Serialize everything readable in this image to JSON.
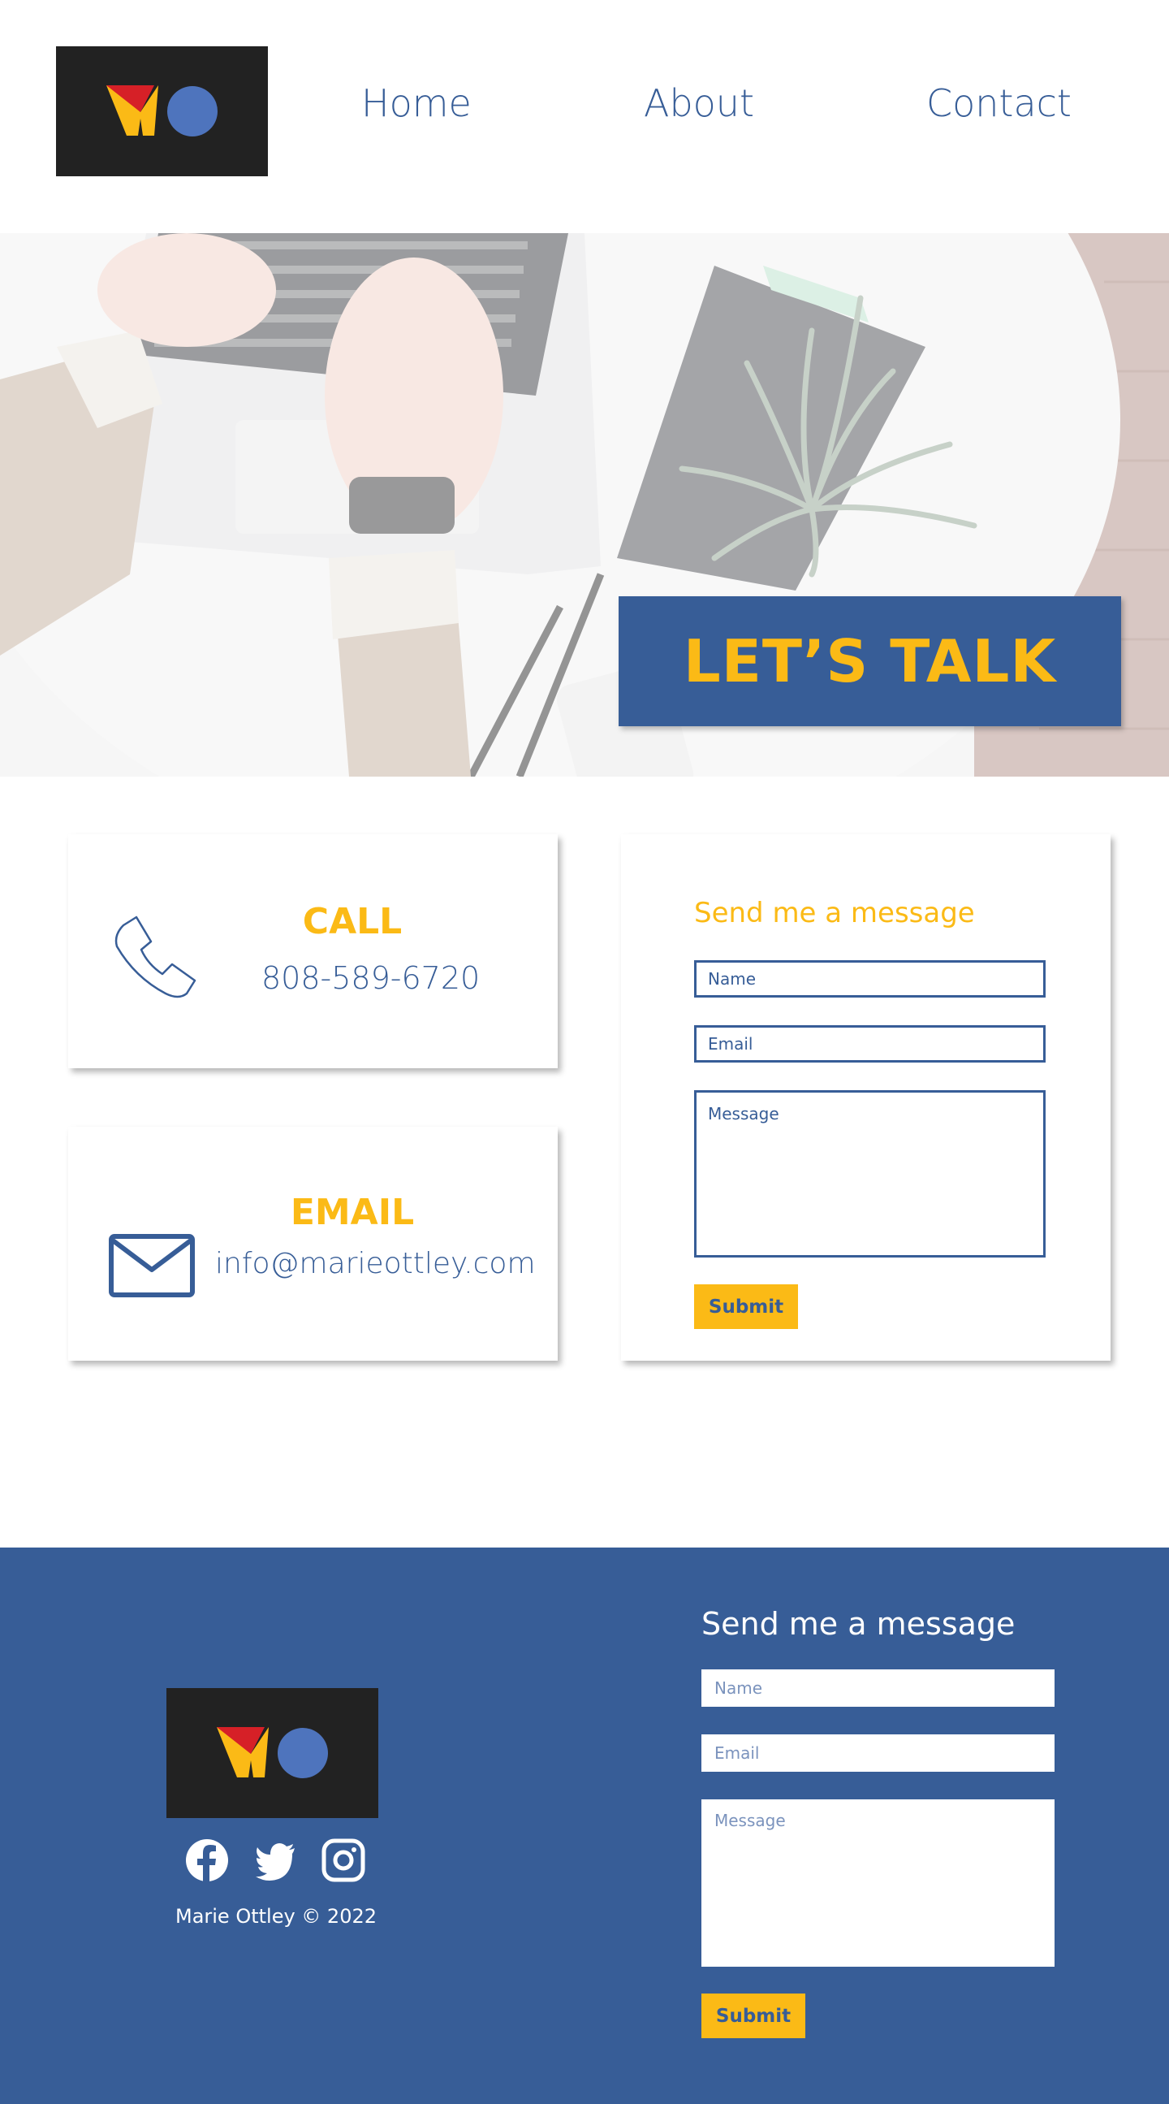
{
  "header": {
    "logo_icon": "mo-logo-icon",
    "nav": [
      {
        "label": "Home"
      },
      {
        "label": "About"
      },
      {
        "label": "Contact"
      }
    ]
  },
  "hero": {
    "image": "laptop-desk-photo",
    "title": "LET’S TALK"
  },
  "contact": {
    "call": {
      "title": "CALL",
      "value": "808-589-6720",
      "icon": "phone-icon"
    },
    "email": {
      "title": "EMAIL",
      "value": "info@marieottley.com",
      "icon": "mail-icon"
    },
    "form": {
      "title": "Send me a message",
      "name_placeholder": "Name",
      "email_placeholder": "Email",
      "message_placeholder": "Message",
      "submit_label": "Submit"
    }
  },
  "footer": {
    "logo_icon": "mo-logo-icon",
    "social": [
      {
        "icon": "facebook-icon"
      },
      {
        "icon": "twitter-icon"
      },
      {
        "icon": "instagram-icon"
      }
    ],
    "copyright": "Marie Ottley © 2022",
    "form": {
      "title": "Send me a message",
      "name_placeholder": "Name",
      "email_placeholder": "Email",
      "message_placeholder": "Message",
      "submit_label": "Submit"
    }
  },
  "colors": {
    "brand_blue": "#375d97",
    "accent_yellow": "#fbba16",
    "logo_dark": "#222222",
    "logo_red": "#d62027",
    "logo_circle": "#4e74bd"
  }
}
